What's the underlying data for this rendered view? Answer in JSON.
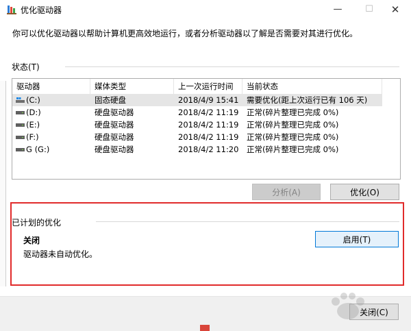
{
  "window": {
    "title": "优化驱动器",
    "minimize_glyph": "—",
    "maximize_glyph": "☐",
    "close_glyph": "✕"
  },
  "intro_text": "你可以优化驱动器以帮助计算机更高效地运行，或者分析驱动器以了解是否需要对其进行优化。",
  "status_section": {
    "label": "状态(T)"
  },
  "drive_table": {
    "columns": [
      "驱动器",
      "媒体类型",
      "上一次运行时间",
      "当前状态"
    ],
    "rows": [
      {
        "drive": "(C:)",
        "media": "固态硬盘",
        "last_run": "2018/4/9 15:41",
        "status": "需要优化(距上次运行已有 106 天)",
        "icon": "windows-drive-icon",
        "selected": true
      },
      {
        "drive": "(D:)",
        "media": "硬盘驱动器",
        "last_run": "2018/4/2 11:19",
        "status": "正常(碎片整理已完成 0%)",
        "icon": "hdd-icon",
        "selected": false
      },
      {
        "drive": "(E:)",
        "media": "硬盘驱动器",
        "last_run": "2018/4/2 11:19",
        "status": "正常(碎片整理已完成 0%)",
        "icon": "hdd-icon",
        "selected": false
      },
      {
        "drive": "(F:)",
        "media": "硬盘驱动器",
        "last_run": "2018/4/2 11:19",
        "status": "正常(碎片整理已完成 0%)",
        "icon": "hdd-icon",
        "selected": false
      },
      {
        "drive": "G (G:)",
        "media": "硬盘驱动器",
        "last_run": "2018/4/2 11:20",
        "status": "正常(碎片整理已完成 0%)",
        "icon": "hdd-icon",
        "selected": false
      }
    ]
  },
  "actions": {
    "analyze_label": "分析(A)",
    "optimize_label": "优化(O)"
  },
  "scheduled_section": {
    "label": "已计划的优化",
    "state_title": "关闭",
    "state_desc": "驱动器未自动优化。",
    "enable_label": "启用(T)"
  },
  "footer": {
    "close_label": "关闭(C)"
  },
  "colors": {
    "highlight_border": "#e12a2a",
    "focus_border": "#0078d7",
    "selected_row": "#e5e5e5"
  }
}
